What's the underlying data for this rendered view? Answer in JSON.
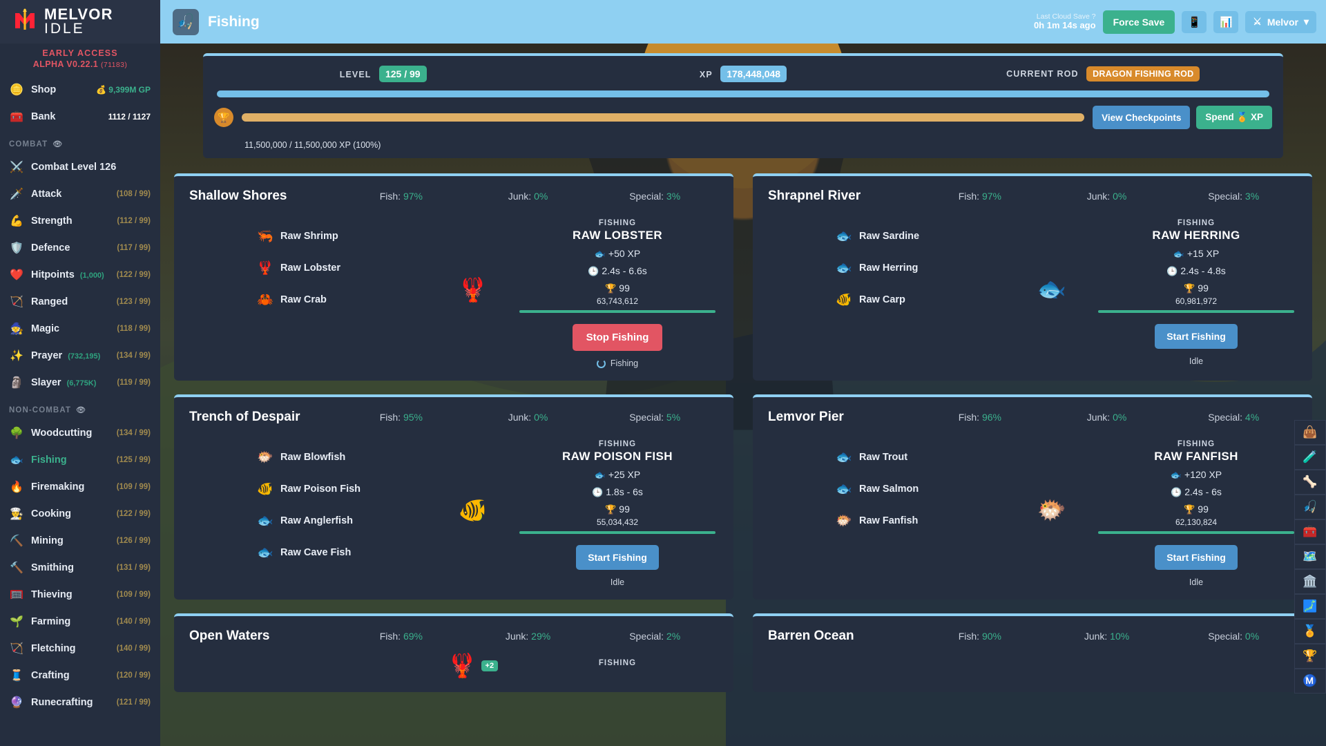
{
  "brand": {
    "line1": "MELVOR",
    "line2": "IDLE",
    "logo_icon": "melvor-m-logo"
  },
  "version": {
    "early_access": "EARLY ACCESS",
    "alpha": "ALPHA V0.22.1",
    "build": "(71183)"
  },
  "sidebar": {
    "shop": {
      "label": "Shop",
      "icon": "coin-icon",
      "value": "9,399M GP",
      "value_icon": "gold-stack-icon"
    },
    "bank": {
      "label": "Bank",
      "icon": "chest-icon",
      "value": "1112 / 1127"
    },
    "combat_header": {
      "label": "COMBAT",
      "eye": "◉"
    },
    "noncombat_header": {
      "label": "NON-COMBAT",
      "eye": "◉"
    },
    "combat": [
      {
        "label": "Combat Level 126",
        "icon": "crossed-swords-icon",
        "glyph": "⚔️",
        "level": ""
      },
      {
        "label": "Attack",
        "icon": "sword-icon",
        "glyph": "🗡️",
        "level": "(108 / 99)"
      },
      {
        "label": "Strength",
        "icon": "biceps-icon",
        "glyph": "💪",
        "level": "(112 / 99)"
      },
      {
        "label": "Defence",
        "icon": "shield-icon",
        "glyph": "🛡️",
        "level": "(117 / 99)"
      },
      {
        "label": "Hitpoints",
        "icon": "heart-icon",
        "glyph": "❤️",
        "sub": "(1,000)",
        "level": "(122 / 99)"
      },
      {
        "label": "Ranged",
        "icon": "bow-icon",
        "glyph": "🏹",
        "level": "(123 / 99)"
      },
      {
        "label": "Magic",
        "icon": "wizard-hat-icon",
        "glyph": "🧙",
        "level": "(118 / 99)"
      },
      {
        "label": "Prayer",
        "icon": "sparkle-icon",
        "glyph": "✨",
        "sub": "(732,195)",
        "level": "(134 / 99)"
      },
      {
        "label": "Slayer",
        "icon": "slayer-icon",
        "glyph": "🗿",
        "sub": "(6,775K)",
        "level": "(119 / 99)"
      }
    ],
    "noncombat": [
      {
        "label": "Woodcutting",
        "icon": "tree-icon",
        "glyph": "🌳",
        "level": "(134 / 99)"
      },
      {
        "label": "Fishing",
        "icon": "fish-icon",
        "glyph": "🐟",
        "level": "(125 / 99)",
        "active": true
      },
      {
        "label": "Firemaking",
        "icon": "fire-icon",
        "glyph": "🔥",
        "level": "(109 / 99)"
      },
      {
        "label": "Cooking",
        "icon": "chef-hat-icon",
        "glyph": "👨‍🍳",
        "level": "(122 / 99)"
      },
      {
        "label": "Mining",
        "icon": "pickaxe-icon",
        "glyph": "⛏️",
        "level": "(126 / 99)"
      },
      {
        "label": "Smithing",
        "icon": "anvil-icon",
        "glyph": "🔨",
        "level": "(131 / 99)"
      },
      {
        "label": "Thieving",
        "icon": "thief-icon",
        "glyph": "🥅",
        "level": "(109 / 99)"
      },
      {
        "label": "Farming",
        "icon": "farming-icon",
        "glyph": "🌱",
        "level": "(140 / 99)"
      },
      {
        "label": "Fletching",
        "icon": "fletching-icon",
        "glyph": "🏹",
        "level": "(140 / 99)"
      },
      {
        "label": "Crafting",
        "icon": "crafting-icon",
        "glyph": "🧵",
        "level": "(120 / 99)"
      },
      {
        "label": "Runecrafting",
        "icon": "runecrafting-icon",
        "glyph": "🔮",
        "level": "(121 / 99)"
      }
    ]
  },
  "topbar": {
    "page_icon": "fishing-rod-icon",
    "page_icon_glyph": "🎣",
    "title": "Fishing",
    "cloud_save_label": "Last Cloud Save",
    "cloud_save_help": "?",
    "cloud_save_time": "0h 1m 14s ago",
    "force_save": "Force Save",
    "mobile_icon": "phone-icon",
    "mobile_glyph": "📱",
    "chart_icon": "bar-chart-icon",
    "chart_glyph": "📊",
    "user_name": "Melvor",
    "user_icon": "crossed-swords-icon",
    "user_glyph": "⚔",
    "chevron": "▾"
  },
  "skill_header": {
    "level_label": "LEVEL",
    "level_value": "125 / 99",
    "xp_label": "XP",
    "xp_value": "178,448,048",
    "rod_label": "CURRENT ROD",
    "rod_value": "DRAGON FISHING ROD",
    "mastery_pool_pct": 100,
    "xp_progress_text": "11,500,000 / 11,500,000 XP (100%)",
    "xp_progress_pct": 100,
    "trophy_icon": "trophy-icon",
    "trophy_glyph": "🏆",
    "view_checkpoints": "View Checkpoints",
    "spend_label": "Spend",
    "spend_suffix": "XP",
    "spend_icon": "mastery-icon",
    "spend_glyph": "🏅",
    "accent": "#8fd0f2"
  },
  "areas": [
    {
      "name": "Shallow Shores",
      "fish_label": "Fish:",
      "fish_pct": "97%",
      "junk_label": "Junk:",
      "junk_pct": "0%",
      "special_label": "Special:",
      "special_pct": "3%",
      "fishes": [
        {
          "name": "Raw Shrimp",
          "icon": "raw-shrimp-icon",
          "glyph": "🦐"
        },
        {
          "name": "Raw Lobster",
          "icon": "raw-lobster-icon",
          "glyph": "🦞"
        },
        {
          "name": "Raw Crab",
          "icon": "raw-crab-icon",
          "glyph": "🦀"
        }
      ],
      "art_glyph": "🦞",
      "art_icon": "lobster-art-icon",
      "action": {
        "kicker": "FISHING",
        "name": "RAW LOBSTER",
        "xp": "+50 XP",
        "xp_icon": "fish-xp-icon",
        "xp_glyph": "🐟",
        "interval": "2.4s - 6.6s",
        "clock_icon": "clock-icon",
        "clock_glyph": "🕒",
        "mastery_level": "99",
        "mastery_icon": "trophy-icon",
        "mastery_glyph": "🏆",
        "mastery_xp": "63,743,612",
        "mastery_pct": 100,
        "button": "Stop Fishing",
        "button_kind": "stop",
        "status": "Fishing",
        "status_spinner": true
      }
    },
    {
      "name": "Shrapnel River",
      "fish_label": "Fish:",
      "fish_pct": "97%",
      "junk_label": "Junk:",
      "junk_pct": "0%",
      "special_label": "Special:",
      "special_pct": "3%",
      "fishes": [
        {
          "name": "Raw Sardine",
          "icon": "raw-sardine-icon",
          "glyph": "🐟"
        },
        {
          "name": "Raw Herring",
          "icon": "raw-herring-icon",
          "glyph": "🐟"
        },
        {
          "name": "Raw Carp",
          "icon": "raw-carp-icon",
          "glyph": "🐠"
        }
      ],
      "art_glyph": "🐟",
      "art_icon": "herring-art-icon",
      "action": {
        "kicker": "FISHING",
        "name": "RAW HERRING",
        "xp": "+15 XP",
        "xp_icon": "fish-xp-icon",
        "xp_glyph": "🐟",
        "interval": "2.4s - 4.8s",
        "clock_icon": "clock-icon",
        "clock_glyph": "🕒",
        "mastery_level": "99",
        "mastery_icon": "trophy-icon",
        "mastery_glyph": "🏆",
        "mastery_xp": "60,981,972",
        "mastery_pct": 100,
        "button": "Start Fishing",
        "button_kind": "start",
        "status": "Idle",
        "status_spinner": false
      }
    },
    {
      "name": "Trench of Despair",
      "fish_label": "Fish:",
      "fish_pct": "95%",
      "junk_label": "Junk:",
      "junk_pct": "0%",
      "special_label": "Special:",
      "special_pct": "5%",
      "fishes": [
        {
          "name": "Raw Blowfish",
          "icon": "raw-blowfish-icon",
          "glyph": "🐡"
        },
        {
          "name": "Raw Poison Fish",
          "icon": "raw-poison-fish-icon",
          "glyph": "🐠"
        },
        {
          "name": "Raw Anglerfish",
          "icon": "raw-anglerfish-icon",
          "glyph": "🐟"
        },
        {
          "name": "Raw Cave Fish",
          "icon": "raw-cave-fish-icon",
          "glyph": "🐟"
        }
      ],
      "art_glyph": "🐠",
      "art_icon": "poison-fish-art-icon",
      "action": {
        "kicker": "FISHING",
        "name": "RAW POISON FISH",
        "xp": "+25 XP",
        "xp_icon": "fish-xp-icon",
        "xp_glyph": "🐟",
        "interval": "1.8s - 6s",
        "clock_icon": "clock-icon",
        "clock_glyph": "🕒",
        "mastery_level": "99",
        "mastery_icon": "trophy-icon",
        "mastery_glyph": "🏆",
        "mastery_xp": "55,034,432",
        "mastery_pct": 100,
        "button": "Start Fishing",
        "button_kind": "start",
        "status": "Idle",
        "status_spinner": false
      }
    },
    {
      "name": "Lemvor Pier",
      "fish_label": "Fish:",
      "fish_pct": "96%",
      "junk_label": "Junk:",
      "junk_pct": "0%",
      "special_label": "Special:",
      "special_pct": "4%",
      "fishes": [
        {
          "name": "Raw Trout",
          "icon": "raw-trout-icon",
          "glyph": "🐟"
        },
        {
          "name": "Raw Salmon",
          "icon": "raw-salmon-icon",
          "glyph": "🐟"
        },
        {
          "name": "Raw Fanfish",
          "icon": "raw-fanfish-icon",
          "glyph": "🐡"
        }
      ],
      "art_glyph": "🐡",
      "art_icon": "fanfish-art-icon",
      "action": {
        "kicker": "FISHING",
        "name": "RAW FANFISH",
        "xp": "+120 XP",
        "xp_icon": "fish-xp-icon",
        "xp_glyph": "🐟",
        "interval": "2.4s - 6s",
        "clock_icon": "clock-icon",
        "clock_glyph": "🕒",
        "mastery_level": "99",
        "mastery_icon": "trophy-icon",
        "mastery_glyph": "🏆",
        "mastery_xp": "62,130,824",
        "mastery_pct": 100,
        "button": "Start Fishing",
        "button_kind": "start",
        "status": "Idle",
        "status_spinner": false
      }
    },
    {
      "name": "Open Waters",
      "fish_label": "Fish:",
      "fish_pct": "69%",
      "junk_label": "Junk:",
      "junk_pct": "29%",
      "special_label": "Special:",
      "special_pct": "2%",
      "fishes": [],
      "art_glyph": "🦞",
      "art_icon": "lobster-art-icon",
      "art_badge": "+2",
      "action": {
        "kicker": "FISHING",
        "name": "",
        "xp": "",
        "interval": "",
        "mastery_level": "",
        "mastery_xp": "",
        "mastery_pct": 0,
        "button": "",
        "button_kind": "none",
        "status": "",
        "status_spinner": false
      }
    },
    {
      "name": "Barren Ocean",
      "fish_label": "Fish:",
      "fish_pct": "90%",
      "junk_label": "Junk:",
      "junk_pct": "10%",
      "special_label": "Special:",
      "special_pct": "0%",
      "fishes": [],
      "art_glyph": "",
      "art_icon": "none",
      "action": {
        "kicker": "",
        "name": "",
        "xp": "",
        "interval": "",
        "mastery_level": "",
        "mastery_xp": "",
        "mastery_pct": 0,
        "button": "",
        "button_kind": "none",
        "status": "",
        "status_spinner": false
      }
    }
  ],
  "rail": [
    {
      "icon": "bag-icon",
      "glyph": "👜"
    },
    {
      "icon": "potion-icon",
      "glyph": "🧪"
    },
    {
      "icon": "bone-icon",
      "glyph": "🦴"
    },
    {
      "icon": "fishing-rod-icon",
      "glyph": "🎣"
    },
    {
      "icon": "anvil-icon",
      "glyph": "🧰"
    },
    {
      "icon": "scroll-icon",
      "glyph": "🗺️"
    },
    {
      "icon": "pillar-icon",
      "glyph": "🏛️"
    },
    {
      "icon": "map-icon",
      "glyph": "🗾"
    },
    {
      "icon": "medal-icon",
      "glyph": "🏅"
    },
    {
      "icon": "trophy-icon",
      "glyph": "🏆"
    },
    {
      "icon": "melvor-logo-icon",
      "glyph": "Ⓜ️"
    }
  ]
}
